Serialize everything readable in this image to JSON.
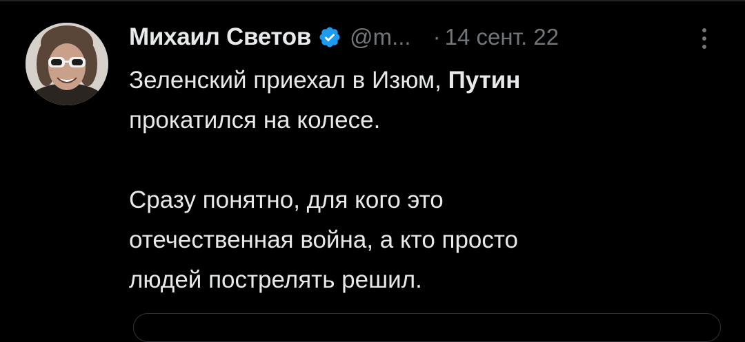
{
  "tweet": {
    "author": {
      "display_name": "Михаил Светов",
      "handle": "@m...",
      "verified": true,
      "avatar_icon": "avatar-photo"
    },
    "separator": "·",
    "timestamp": "14 сент. 22",
    "more_icon": "more-vertical-icon",
    "body": {
      "line1_part1": "Зеленский приехал в Изюм, ",
      "line1_bold": "Путин",
      "line1_part2": "прокатился на колесе.",
      "paragraph2_line1": "Сразу понятно, для кого это",
      "paragraph2_line2": "отечественная война, а кто просто",
      "paragraph2_line3": "людей пострелять решил."
    }
  },
  "colors": {
    "background": "#000000",
    "primary_text": "#e7e9ea",
    "secondary_text": "#71767b",
    "verified_blue": "#1d9bf0",
    "border": "#2f3336"
  }
}
